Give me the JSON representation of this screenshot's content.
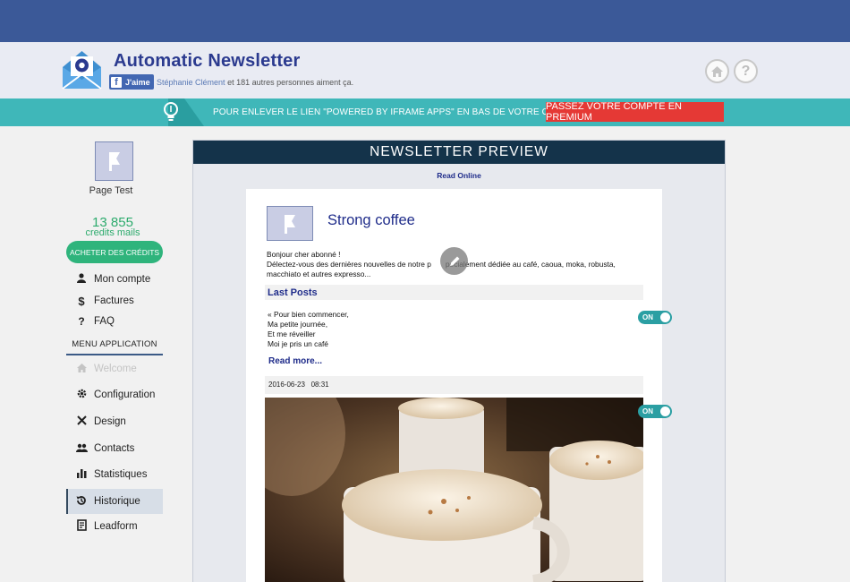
{
  "header": {
    "app_title": "Automatic Newsletter",
    "like_label": "J'aime",
    "like_name": "Stéphanie Clément",
    "like_rest": " et 181 autres personnes aiment ça.",
    "home_icon": "home-icon",
    "help_icon": "help-icon",
    "help_glyph": "?"
  },
  "promo": {
    "message": "POUR ENLEVER LE LIEN \"POWERED BY IFRAME APPS\" EN BAS DE VOTRE ONGLET,",
    "cta": "PASSEZ VOTRE COMPTE EN PREMIUM"
  },
  "sidebar": {
    "page_name": "Page Test",
    "credits_number": "13 855",
    "credits_label": "credits mails",
    "buy_button": "ACHETER DES CRÉDITS",
    "account_items": [
      {
        "label": "Mon compte",
        "icon": "user-icon"
      },
      {
        "label": "Factures",
        "icon": "dollar-icon"
      },
      {
        "label": "FAQ",
        "icon": "question-icon"
      }
    ],
    "menu_title": "MENU APPLICATION",
    "menu_items": [
      {
        "label": "Welcome",
        "icon": "home-icon",
        "state": "disabled"
      },
      {
        "label": "Configuration",
        "icon": "gear-icon"
      },
      {
        "label": "Design",
        "icon": "tools-icon"
      },
      {
        "label": "Contacts",
        "icon": "users-icon"
      },
      {
        "label": "Statistiques",
        "icon": "bar-chart-icon"
      },
      {
        "label": "Historique",
        "icon": "history-icon",
        "state": "active"
      },
      {
        "label": "Leadform",
        "icon": "form-icon"
      }
    ]
  },
  "preview": {
    "heading": "NEWSLETTER PREVIEW",
    "read_online": "Read Online",
    "mail_title": "Strong coffee",
    "intro_line1": "Bonjour cher abonné !",
    "intro_line2": "Délectez-vous des dernières nouvelles de notre p",
    "intro_line2_end": "pécialement dédiée au café, caoua, moka, robusta,",
    "intro_line3": "macchiato et autres expresso...",
    "section_title": "Last Posts",
    "poem": [
      "« Pour bien commencer,",
      "Ma petite journée,",
      "Et me réveiller",
      "Moi je pris un café"
    ],
    "read_more": "Read more...",
    "date": "2016-06-23",
    "time": "08:31",
    "toggle_label": "ON",
    "image": "coffee-cups-photo"
  },
  "colors": {
    "facebook_bar": "#3b5998",
    "brand_text": "#2b3a8f",
    "promo_bar": "#3fb7b9",
    "cta_red": "#e53935",
    "credits_green": "#2dab6d",
    "preview_header": "#14334a",
    "toggle_teal": "#2b9fa3"
  }
}
